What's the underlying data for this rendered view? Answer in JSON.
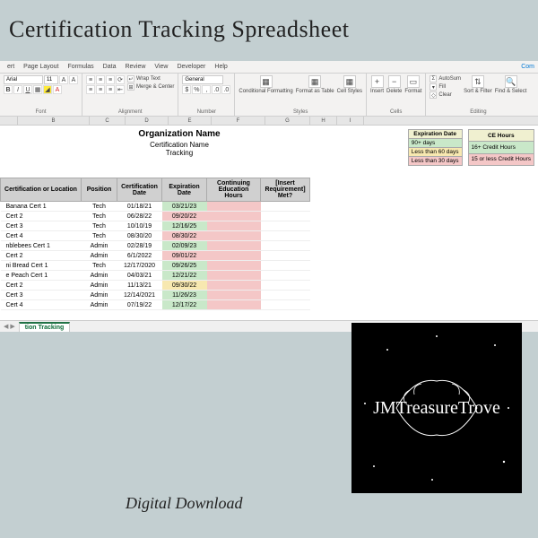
{
  "page_title": "Certification Tracking Spreadsheet",
  "digital_download": "Digital Download",
  "logo_text": "JMTreasureTrove",
  "ribbon": {
    "tabs": [
      "ert",
      "Page Layout",
      "Formulas",
      "Data",
      "Review",
      "View",
      "Developer",
      "Help"
    ],
    "com_label": "Com",
    "font_name": "Arial",
    "font_size": "11",
    "wrap": "Wrap Text",
    "merge": "Merge & Center",
    "number_fmt": "General",
    "cond_fmt": "Conditional Formatting",
    "fmt_table": "Format as Table",
    "cell_styles": "Cell Styles",
    "insert": "Insert",
    "delete": "Delete",
    "format": "Format",
    "autosum": "AutoSum",
    "fill": "Fill",
    "clear": "Clear",
    "sort": "Sort & Filter",
    "find": "Find & Select",
    "groups": {
      "font": "Font",
      "alignment": "Alignment",
      "number": "Number",
      "styles": "Styles",
      "cells": "Cells",
      "editing": "Editing"
    }
  },
  "columns": [
    "",
    "B",
    "C",
    "D",
    "E",
    "F",
    "G",
    "H",
    "I"
  ],
  "headings": {
    "org": "Organization Name",
    "cert_name": "Certification Name",
    "tracking": "Tracking"
  },
  "legend": {
    "exp_header": "Expiration Date",
    "ce_header": "CE Hours",
    "exp": [
      "90+ days",
      "Less than 60 days",
      "Less than 30 days"
    ],
    "ce": [
      "16+ Credit Hours",
      "15 or less Credit Hours"
    ]
  },
  "table_headers": [
    "Certification or Location",
    "Position",
    "Certification Date",
    "Expiration Date",
    "Continuing Education Hours",
    "[Insert Requirement] Met?"
  ],
  "rows": [
    {
      "name": "Banana Cert 1",
      "pos": "Tech",
      "cd": "01/18/21",
      "ed": "03/21/23",
      "cls": "lg-green"
    },
    {
      "name": "Cert 2",
      "pos": "Tech",
      "cd": "06/28/22",
      "ed": "09/20/22",
      "cls": "lg-pink"
    },
    {
      "name": "Cert 3",
      "pos": "Tech",
      "cd": "10/10/19",
      "ed": "12/16/25",
      "cls": "lg-green"
    },
    {
      "name": "Cert 4",
      "pos": "Tech",
      "cd": "08/30/20",
      "ed": "08/30/22",
      "cls": "lg-pink"
    },
    {
      "name": "nblebees Cert 1",
      "pos": "Admin",
      "cd": "02/28/19",
      "ed": "02/09/23",
      "cls": "lg-green"
    },
    {
      "name": "Cert 2",
      "pos": "Admin",
      "cd": "6/1/2022",
      "ed": "09/01/22",
      "cls": "lg-pink"
    },
    {
      "name": "ni Bread Cert 1",
      "pos": "Tech",
      "cd": "12/17/2020",
      "ed": "09/26/25",
      "cls": "lg-green"
    },
    {
      "name": "e Peach Cert 1",
      "pos": "Admin",
      "cd": "04/03/21",
      "ed": "12/21/22",
      "cls": "lg-green"
    },
    {
      "name": "Cert 2",
      "pos": "Admin",
      "cd": "11/13/21",
      "ed": "09/30/22",
      "cls": "lg-yellow"
    },
    {
      "name": "Cert 3",
      "pos": "Admin",
      "cd": "12/14/2021",
      "ed": "11/26/23",
      "cls": "lg-green"
    },
    {
      "name": "Cert 4",
      "pos": "Admin",
      "cd": "07/19/22",
      "ed": "12/17/22",
      "cls": "lg-green"
    }
  ],
  "sheet_tab": "tion Tracking"
}
